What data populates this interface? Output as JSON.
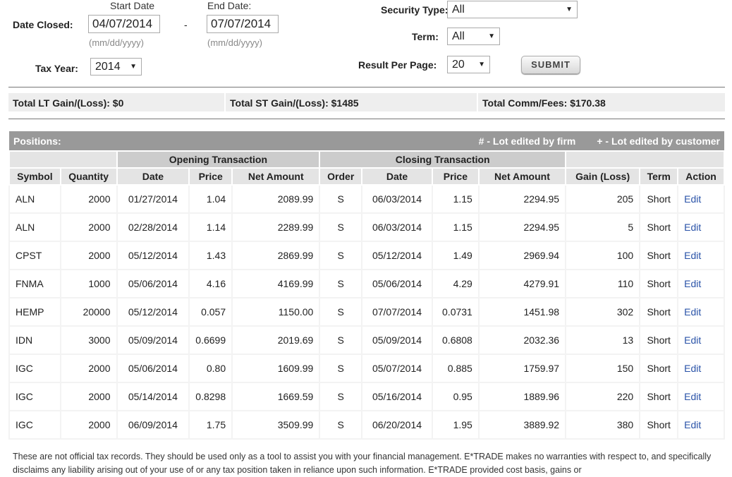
{
  "filters": {
    "date_closed_label": "Date Closed:",
    "start_label": "Start Date",
    "end_label": "End Date:",
    "start_value": "04/07/2014",
    "end_value": "07/07/2014",
    "dash": "-",
    "format_hint": "(mm/dd/yyyy)",
    "tax_year_label": "Tax Year:",
    "tax_year_value": "2014",
    "security_type_label": "Security Type:",
    "security_type_value": "All",
    "term_label": "Term:",
    "term_value": "All",
    "result_label": "Result Per Page:",
    "result_value": "20",
    "submit_label": "SUBMIT"
  },
  "totals": {
    "lt": "Total LT Gain/(Loss): $0",
    "st": "Total ST Gain/(Loss): $1485",
    "fees": "Total Comm/Fees: $170.38"
  },
  "positions": {
    "title": "Positions:",
    "legend_firm": "# - Lot edited by firm",
    "legend_customer": "+ - Lot edited by customer",
    "group_open": "Opening Transaction",
    "group_close": "Closing Transaction",
    "columns": [
      "Symbol",
      "Quantity",
      "Date",
      "Price",
      "Net Amount",
      "Order",
      "Date",
      "Price",
      "Net Amount",
      "Gain (Loss)",
      "Term",
      "Action"
    ],
    "rows": [
      [
        "ALN",
        "2000",
        "01/27/2014",
        "1.04",
        "2089.99",
        "S",
        "06/03/2014",
        "1.15",
        "2294.95",
        "205",
        "Short",
        "Edit"
      ],
      [
        "ALN",
        "2000",
        "02/28/2014",
        "1.14",
        "2289.99",
        "S",
        "06/03/2014",
        "1.15",
        "2294.95",
        "5",
        "Short",
        "Edit"
      ],
      [
        "CPST",
        "2000",
        "05/12/2014",
        "1.43",
        "2869.99",
        "S",
        "05/12/2014",
        "1.49",
        "2969.94",
        "100",
        "Short",
        "Edit"
      ],
      [
        "FNMA",
        "1000",
        "05/06/2014",
        "4.16",
        "4169.99",
        "S",
        "05/06/2014",
        "4.29",
        "4279.91",
        "110",
        "Short",
        "Edit"
      ],
      [
        "HEMP",
        "20000",
        "05/12/2014",
        "0.057",
        "1150.00",
        "S",
        "07/07/2014",
        "0.0731",
        "1451.98",
        "302",
        "Short",
        "Edit"
      ],
      [
        "IDN",
        "3000",
        "05/09/2014",
        "0.6699",
        "2019.69",
        "S",
        "05/09/2014",
        "0.6808",
        "2032.36",
        "13",
        "Short",
        "Edit"
      ],
      [
        "IGC",
        "2000",
        "05/06/2014",
        "0.80",
        "1609.99",
        "S",
        "05/07/2014",
        "0.885",
        "1759.97",
        "150",
        "Short",
        "Edit"
      ],
      [
        "IGC",
        "2000",
        "05/14/2014",
        "0.8298",
        "1669.59",
        "S",
        "05/16/2014",
        "0.95",
        "1889.96",
        "220",
        "Short",
        "Edit"
      ],
      [
        "IGC",
        "2000",
        "06/09/2014",
        "1.75",
        "3509.99",
        "S",
        "06/20/2014",
        "1.95",
        "3889.92",
        "380",
        "Short",
        "Edit"
      ]
    ]
  },
  "disclaimer": "These are not official tax records. They should be used only as a tool to assist you with your financial management. E*TRADE makes no warranties with respect to, and specifically disclaims any liability arising out of your use of or any tax position taken in reliance upon such information. E*TRADE provided cost basis, gains or"
}
